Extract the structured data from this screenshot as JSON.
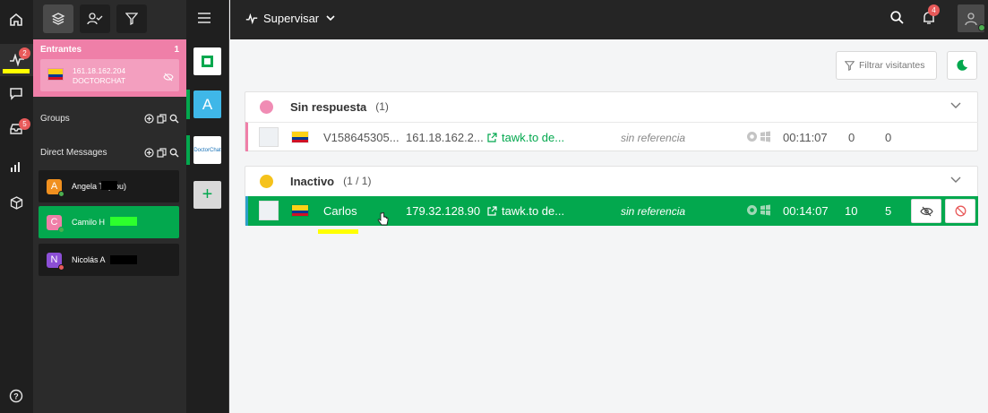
{
  "rail": {
    "monitor_badge": "2",
    "inbox_badge": "5"
  },
  "panel": {
    "incoming": {
      "label": "Entrantes",
      "count": "1",
      "ip": "161.18.162.204",
      "source": "DOCTORCHAT"
    },
    "groups_label": "Groups",
    "dm_label": "Direct Messages",
    "dms": [
      {
        "initial": "A",
        "name": "Angela T",
        "suffix": "(You)",
        "color": "#f0901f",
        "status": "#4caf50"
      },
      {
        "initial": "C",
        "name": "Camilo H",
        "suffix": "",
        "color": "#ef7fa8",
        "status": "#4caf50"
      },
      {
        "initial": "N",
        "name": "Nicolás A",
        "suffix": "",
        "color": "#8c4fd6",
        "status": "#e85a5a"
      }
    ]
  },
  "mid": {
    "tile_a": "A",
    "tile_logo": "DoctorChat",
    "add": "+"
  },
  "topbar": {
    "title": "Supervisar",
    "notif_badge": "4"
  },
  "content": {
    "filter_label": "Filtrar visitantes",
    "groups": [
      {
        "title": "Sin respuesta",
        "count": "(1)",
        "dot": "#f08cb4",
        "row": {
          "name": "V158645305...",
          "ip": "161.18.162.2...",
          "page": "tawk.to de...",
          "ref": "sin referencia",
          "time": "00:11:07",
          "chats": "0",
          "visits": "0"
        }
      },
      {
        "title": "Inactivo",
        "count": "(1 / 1)",
        "dot": "#f5c21b",
        "row": {
          "name": "Carlos",
          "ip": "179.32.128.90",
          "page": "tawk.to de...",
          "ref": "sin referencia",
          "time": "00:14:07",
          "chats": "10",
          "visits": "5"
        }
      }
    ]
  },
  "colors": {
    "accent_green": "#03a84e",
    "pink": "#ef7fa8",
    "highlight_yellow": "#ffff00"
  }
}
